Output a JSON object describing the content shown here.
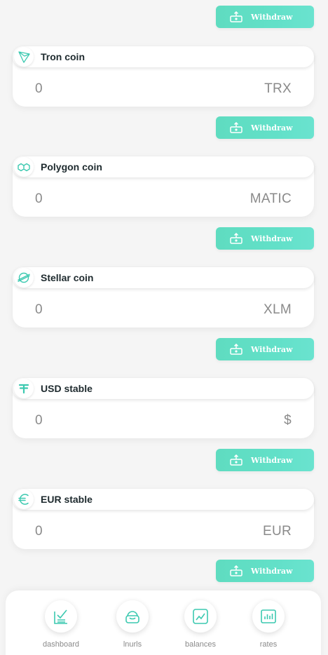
{
  "colors": {
    "accent": "#5fdcc0",
    "text_dark": "#1e2a2e",
    "text_muted": "#8a8a8a"
  },
  "withdraw_label": "Withdraw",
  "coins": [
    {
      "icon": "tron-icon",
      "name": "Tron coin",
      "amount": "0",
      "unit": "TRX"
    },
    {
      "icon": "polygon-icon",
      "name": "Polygon coin",
      "amount": "0",
      "unit": "MATIC"
    },
    {
      "icon": "stellar-icon",
      "name": "Stellar coin",
      "amount": "0",
      "unit": "XLM"
    },
    {
      "icon": "tether-icon",
      "name": "USD stable",
      "amount": "0",
      "unit": "$"
    },
    {
      "icon": "euro-icon",
      "name": "EUR stable",
      "amount": "0",
      "unit": "EUR"
    }
  ],
  "nav": [
    {
      "icon": "dashboard-icon",
      "label": "dashboard"
    },
    {
      "icon": "lnurls-icon",
      "label": "lnurls"
    },
    {
      "icon": "balances-icon",
      "label": "balances"
    },
    {
      "icon": "rates-icon",
      "label": "rates"
    }
  ]
}
